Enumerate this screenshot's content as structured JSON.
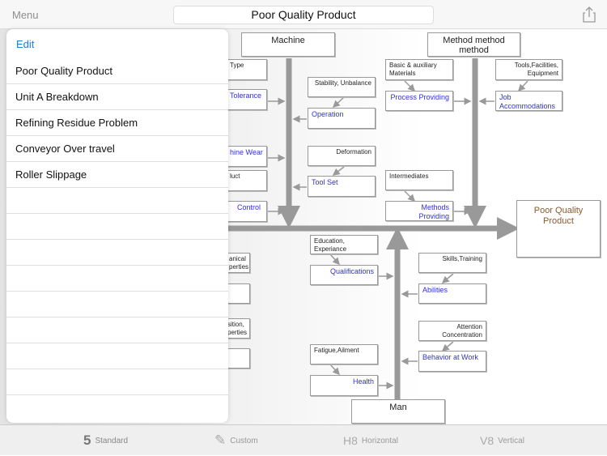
{
  "header": {
    "menu_label": "Menu",
    "title": "Poor Quality Product",
    "share_icon": "share-icon"
  },
  "popover": {
    "edit_label": "Edit",
    "items": [
      "Poor Quality Product",
      "Unit A Breakdown",
      "Refining Residue Problem",
      "Conveyor Over travel",
      "Roller Slippage"
    ]
  },
  "diagram": {
    "effect": "Poor Quality Product",
    "effect_color": "#8b5a2b",
    "cause_color": "#3030d8",
    "categories": {
      "machine": "Machine",
      "method": "Method method method",
      "man": "Man"
    },
    "machine_left": [
      "Type",
      "Tolerance",
      "hine Wear",
      "luct",
      "Control"
    ],
    "machine_right": [
      {
        "cause": "Operation",
        "detail": "Stability, Unbalance"
      },
      {
        "cause": "Tool Set",
        "detail": "Deformation"
      }
    ],
    "method_left": [
      {
        "cause": "Process Providing",
        "detail": "Basic & auxiliary Materials"
      },
      {
        "cause": "Methods Providing",
        "detail": "Intermediates"
      }
    ],
    "method_right": [
      {
        "cause": "Job Accommodations",
        "detail": "Tools,Facilities, Equipment"
      }
    ],
    "lower_left_partial": [
      "anical perties",
      "",
      "sition, perties",
      ""
    ],
    "man_left": [
      {
        "cause": "Qualifications",
        "detail": "Education, Experiance"
      },
      {
        "cause": "Health",
        "detail": "Fatigue,Ailment"
      }
    ],
    "man_right": [
      {
        "cause": "Abilities",
        "detail": "Skills,Training"
      },
      {
        "cause": "Behavior at Work",
        "detail": "Attention Concentration"
      }
    ]
  },
  "tabs": [
    {
      "label": "Standard",
      "icon": "5"
    },
    {
      "label": "Custom",
      "icon": "✎"
    },
    {
      "label": "Horizontal",
      "icon": "H8"
    },
    {
      "label": "Vertical",
      "icon": "V8"
    }
  ]
}
